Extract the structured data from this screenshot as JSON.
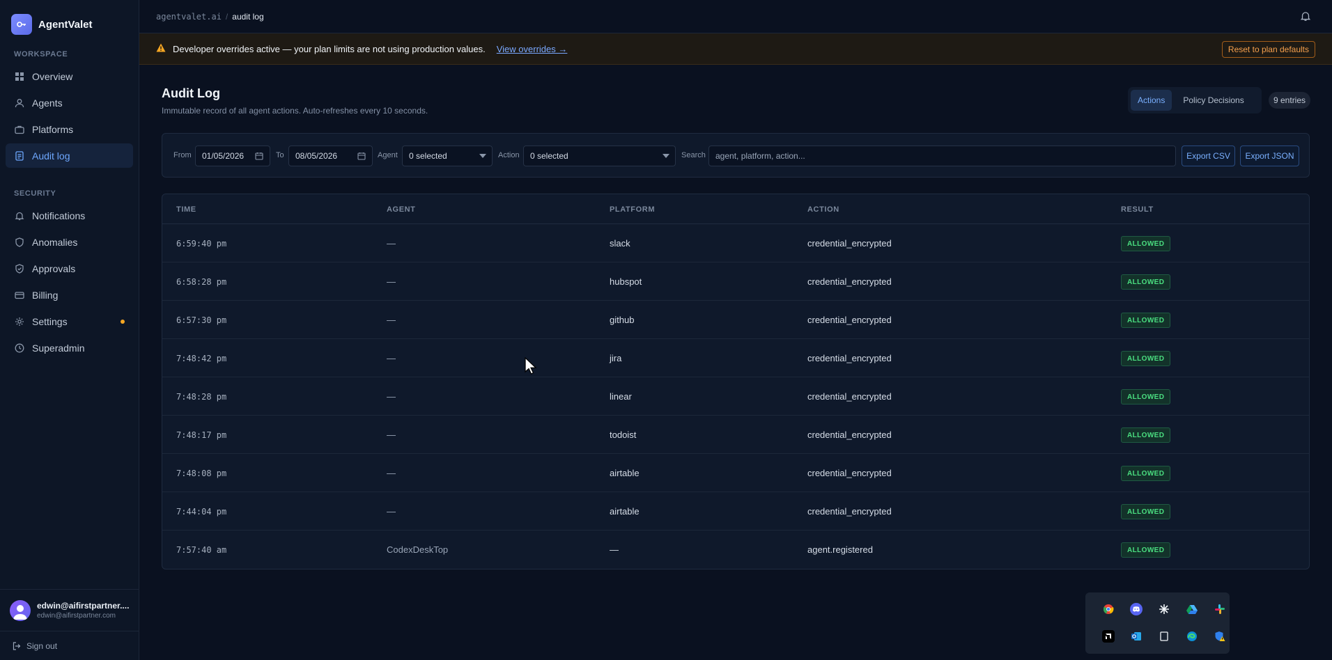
{
  "brand": {
    "name": "AgentValet"
  },
  "sidebar": {
    "workspace_label": "WORKSPACE",
    "workspace_items": [
      {
        "label": "Overview",
        "icon": "grid-icon"
      },
      {
        "label": "Agents",
        "icon": "user-icon"
      },
      {
        "label": "Platforms",
        "icon": "briefcase-icon"
      },
      {
        "label": "Audit log",
        "icon": "document-icon",
        "active": true
      }
    ],
    "security_label": "SECURITY",
    "security_items": [
      {
        "label": "Notifications",
        "icon": "bell-icon"
      },
      {
        "label": "Anomalies",
        "icon": "shield-icon"
      },
      {
        "label": "Approvals",
        "icon": "check-shield-icon"
      },
      {
        "label": "Billing",
        "icon": "credit-card-icon"
      },
      {
        "label": "Settings",
        "icon": "gear-icon",
        "indicator_color": "#f5a623"
      },
      {
        "label": "Superadmin",
        "icon": "clock-icon"
      }
    ],
    "user": {
      "name": "edwin@aifirstpartner....",
      "email": "edwin@aifirstpartner.com"
    },
    "signout_label": "Sign out"
  },
  "topbar": {
    "breadcrumb_root": "agentvalet.ai",
    "breadcrumb_sep": "/",
    "breadcrumb_current": "audit log"
  },
  "banner": {
    "message": "Developer overrides active — your plan limits are not using production values.",
    "link": "View overrides →",
    "reset_button": "Reset to plan defaults"
  },
  "page": {
    "title": "Audit Log",
    "subtitle": "Immutable record of all agent actions. Auto-refreshes every 10 seconds.",
    "tabs": [
      "Actions",
      "Policy Decisions"
    ],
    "active_tab": "Actions",
    "entries": "9 entries"
  },
  "filters": {
    "from_label": "From",
    "from_value": "01/05/2026",
    "to_label": "To",
    "to_value": "08/05/2026",
    "agent_label": "Agent",
    "agent_value": "0 selected",
    "action_label": "Action",
    "action_value": "0 selected",
    "search_label": "Search",
    "search_placeholder": "agent, platform, action...",
    "export_csv": "Export CSV",
    "export_json": "Export JSON"
  },
  "table": {
    "headers": [
      "TIME",
      "AGENT",
      "PLATFORM",
      "ACTION",
      "RESULT"
    ],
    "rows": [
      {
        "time": "6:59:40 pm",
        "agent": "—",
        "platform": "slack",
        "action": "credential_encrypted",
        "result": "ALLOWED"
      },
      {
        "time": "6:58:28 pm",
        "agent": "—",
        "platform": "hubspot",
        "action": "credential_encrypted",
        "result": "ALLOWED"
      },
      {
        "time": "6:57:30 pm",
        "agent": "—",
        "platform": "github",
        "action": "credential_encrypted",
        "result": "ALLOWED"
      },
      {
        "time": "7:48:42 pm",
        "agent": "—",
        "platform": "jira",
        "action": "credential_encrypted",
        "result": "ALLOWED"
      },
      {
        "time": "7:48:28 pm",
        "agent": "—",
        "platform": "linear",
        "action": "credential_encrypted",
        "result": "ALLOWED"
      },
      {
        "time": "7:48:17 pm",
        "agent": "—",
        "platform": "todoist",
        "action": "credential_encrypted",
        "result": "ALLOWED"
      },
      {
        "time": "7:48:08 pm",
        "agent": "—",
        "platform": "airtable",
        "action": "credential_encrypted",
        "result": "ALLOWED"
      },
      {
        "time": "7:44:04 pm",
        "agent": "—",
        "platform": "airtable",
        "action": "credential_encrypted",
        "result": "ALLOWED"
      },
      {
        "time": "7:57:40 am",
        "agent": "CodexDeskTop",
        "platform": "—",
        "action": "agent.registered",
        "result": "ALLOWED"
      }
    ]
  },
  "tray": {
    "icons": [
      "chrome-icon",
      "discord-icon",
      "sparkle-icon",
      "drive-icon",
      "slack-icon",
      "amd-icon",
      "outlook-icon",
      "tablet-icon",
      "edge-icon",
      "defender-warning-icon"
    ]
  },
  "colors": {
    "accent": "#6ea8ff",
    "success": "#4ade80",
    "warning": "#f5a623",
    "background": "#0a1120"
  }
}
